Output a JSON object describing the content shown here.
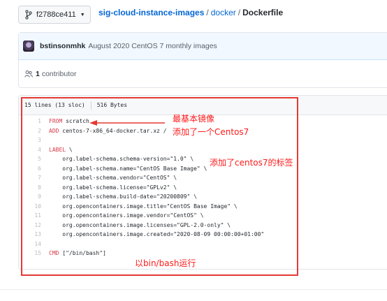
{
  "branch": {
    "name": "f2788ce411"
  },
  "breadcrumb": {
    "repo": "sig-cloud-instance-images",
    "folder": "docker",
    "sep": "/",
    "file": "Dockerfile"
  },
  "commit": {
    "author": "bstinsonmhk",
    "message": "August 2020 CentOS 7 monthly images"
  },
  "contributors": {
    "count": "1",
    "label": "contributor"
  },
  "file": {
    "lines": "15 lines (13 sloc)",
    "size": "516 Bytes"
  },
  "code": [
    {
      "n": "1",
      "kw": "FROM",
      "rest": " scratch"
    },
    {
      "n": "2",
      "kw": "ADD",
      "rest": " centos-7-x86_64-docker.tar.xz /"
    },
    {
      "n": "3",
      "kw": "",
      "rest": ""
    },
    {
      "n": "4",
      "kw": "LABEL",
      "rest": " \\"
    },
    {
      "n": "5",
      "kw": "",
      "rest": "    org.label-schema.schema-version=\"1.0\" \\"
    },
    {
      "n": "6",
      "kw": "",
      "rest": "    org.label-schema.name=\"CentOS Base Image\" \\"
    },
    {
      "n": "7",
      "kw": "",
      "rest": "    org.label-schema.vendor=\"CentOS\" \\"
    },
    {
      "n": "8",
      "kw": "",
      "rest": "    org.label-schema.license=\"GPLv2\" \\"
    },
    {
      "n": "9",
      "kw": "",
      "rest": "    org.label-schema.build-date=\"20200809\" \\"
    },
    {
      "n": "10",
      "kw": "",
      "rest": "    org.opencontainers.image.title=\"CentOS Base Image\" \\"
    },
    {
      "n": "11",
      "kw": "",
      "rest": "    org.opencontainers.image.vendor=\"CentOS\" \\"
    },
    {
      "n": "12",
      "kw": "",
      "rest": "    org.opencontainers.image.licenses=\"GPL-2.0-only\" \\"
    },
    {
      "n": "13",
      "kw": "",
      "rest": "    org.opencontainers.image.created=\"2020-08-09 00:00:00+01:00\""
    },
    {
      "n": "14",
      "kw": "",
      "rest": ""
    },
    {
      "n": "15",
      "kw": "CMD",
      "rest": " [\"/bin/bash\"]"
    }
  ],
  "annotations": {
    "base_image": "最基本镜像",
    "added_centos": "添加了一个Centos7",
    "added_labels": "添加了centos7的标签",
    "run_bash": "以bin/bash运行"
  },
  "colors": {
    "link": "#0366d6",
    "keyword": "#d73a49",
    "annotation": "#ff1a1a"
  }
}
